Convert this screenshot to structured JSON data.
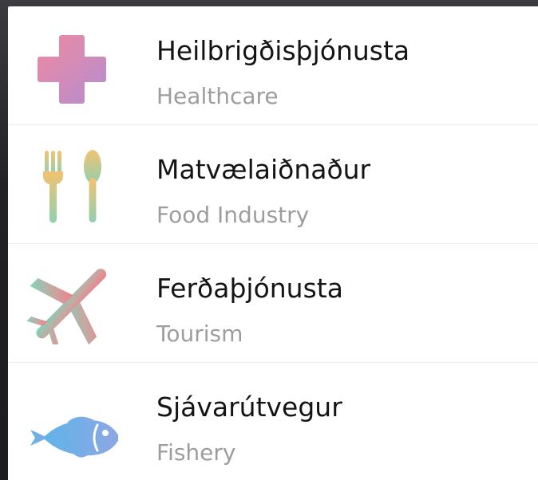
{
  "list": {
    "items": [
      {
        "title": "Heilbrigðisþjónusta",
        "subtitle": "Healthcare",
        "icon": "medical-cross-icon"
      },
      {
        "title": "Matvælaiðnaður",
        "subtitle": "Food Industry",
        "icon": "fork-spoon-icon"
      },
      {
        "title": "Ferðaþjónusta",
        "subtitle": "Tourism",
        "icon": "airplane-icon"
      },
      {
        "title": "Sjávarútvegur",
        "subtitle": "Fishery",
        "icon": "fish-icon"
      }
    ]
  },
  "colors": {
    "panel_background": "#ffffff",
    "title_text": "#141414",
    "subtitle_text": "#9d9d9d",
    "divider": "#ececee",
    "backdrop": "#222226"
  }
}
